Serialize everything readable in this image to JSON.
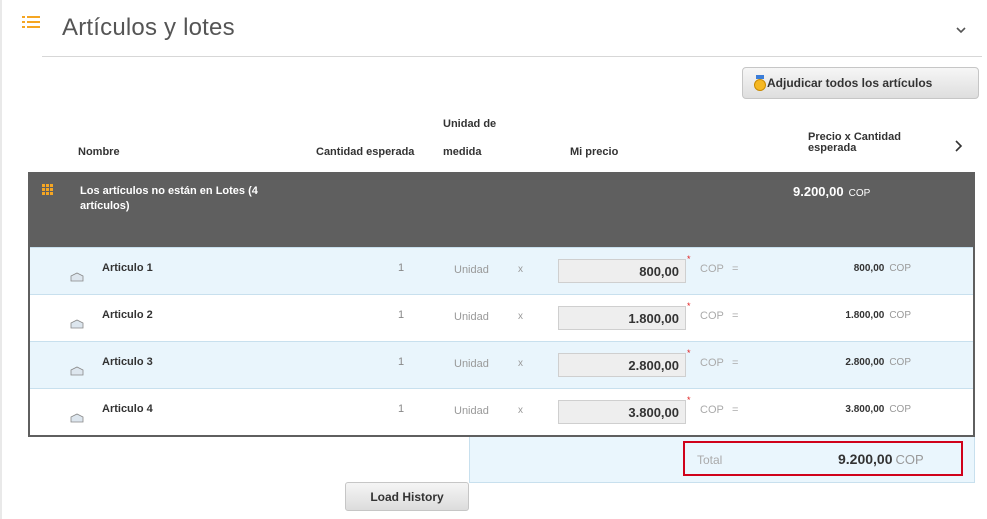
{
  "section": {
    "title": "Artículos y lotes"
  },
  "toolbar": {
    "award_all_label": "Adjudicar todos los artículos"
  },
  "columns": {
    "name": "Nombre",
    "expected_qty": "Cantidad esperada",
    "unit_line1": "Unidad de",
    "unit_line2": "medida",
    "my_price": "Mi precio",
    "price_qty_line1": "Precio x Cantidad",
    "price_qty_line2": "esperada"
  },
  "group": {
    "name": "Los artículos no están en Lotes (4 artículos)",
    "total": "9.200,00",
    "currency": "COP"
  },
  "items": [
    {
      "name": "Articulo 1",
      "qty": "1",
      "unit": "Unidad",
      "times": "x",
      "price": "800,00",
      "currency": "COP",
      "equals": "=",
      "line_total": "800,00"
    },
    {
      "name": "Articulo 2",
      "qty": "1",
      "unit": "Unidad",
      "times": "x",
      "price": "1.800,00",
      "currency": "COP",
      "equals": "=",
      "line_total": "1.800,00"
    },
    {
      "name": "Articulo 3",
      "qty": "1",
      "unit": "Unidad",
      "times": "x",
      "price": "2.800,00",
      "currency": "COP",
      "equals": "=",
      "line_total": "2.800,00"
    },
    {
      "name": "Articulo 4",
      "qty": "1",
      "unit": "Unidad",
      "times": "x",
      "price": "3.800,00",
      "currency": "COP",
      "equals": "=",
      "line_total": "3.800,00"
    }
  ],
  "summary": {
    "label": "Total",
    "value": "9.200,00",
    "currency": "COP"
  },
  "actions": {
    "load_history_label": "Load History"
  },
  "icons": {
    "section": "list-icon",
    "collapse": "chevron-down-icon",
    "award": "medal-icon",
    "scroll": "chevron-right-icon",
    "group": "grid-icon",
    "item": "item-box-icon"
  },
  "colors": {
    "accent": "#f5a623",
    "group_bg": "#5f5f5f",
    "row_alt": "#e9f5fc",
    "highlight": "#d0021b"
  }
}
